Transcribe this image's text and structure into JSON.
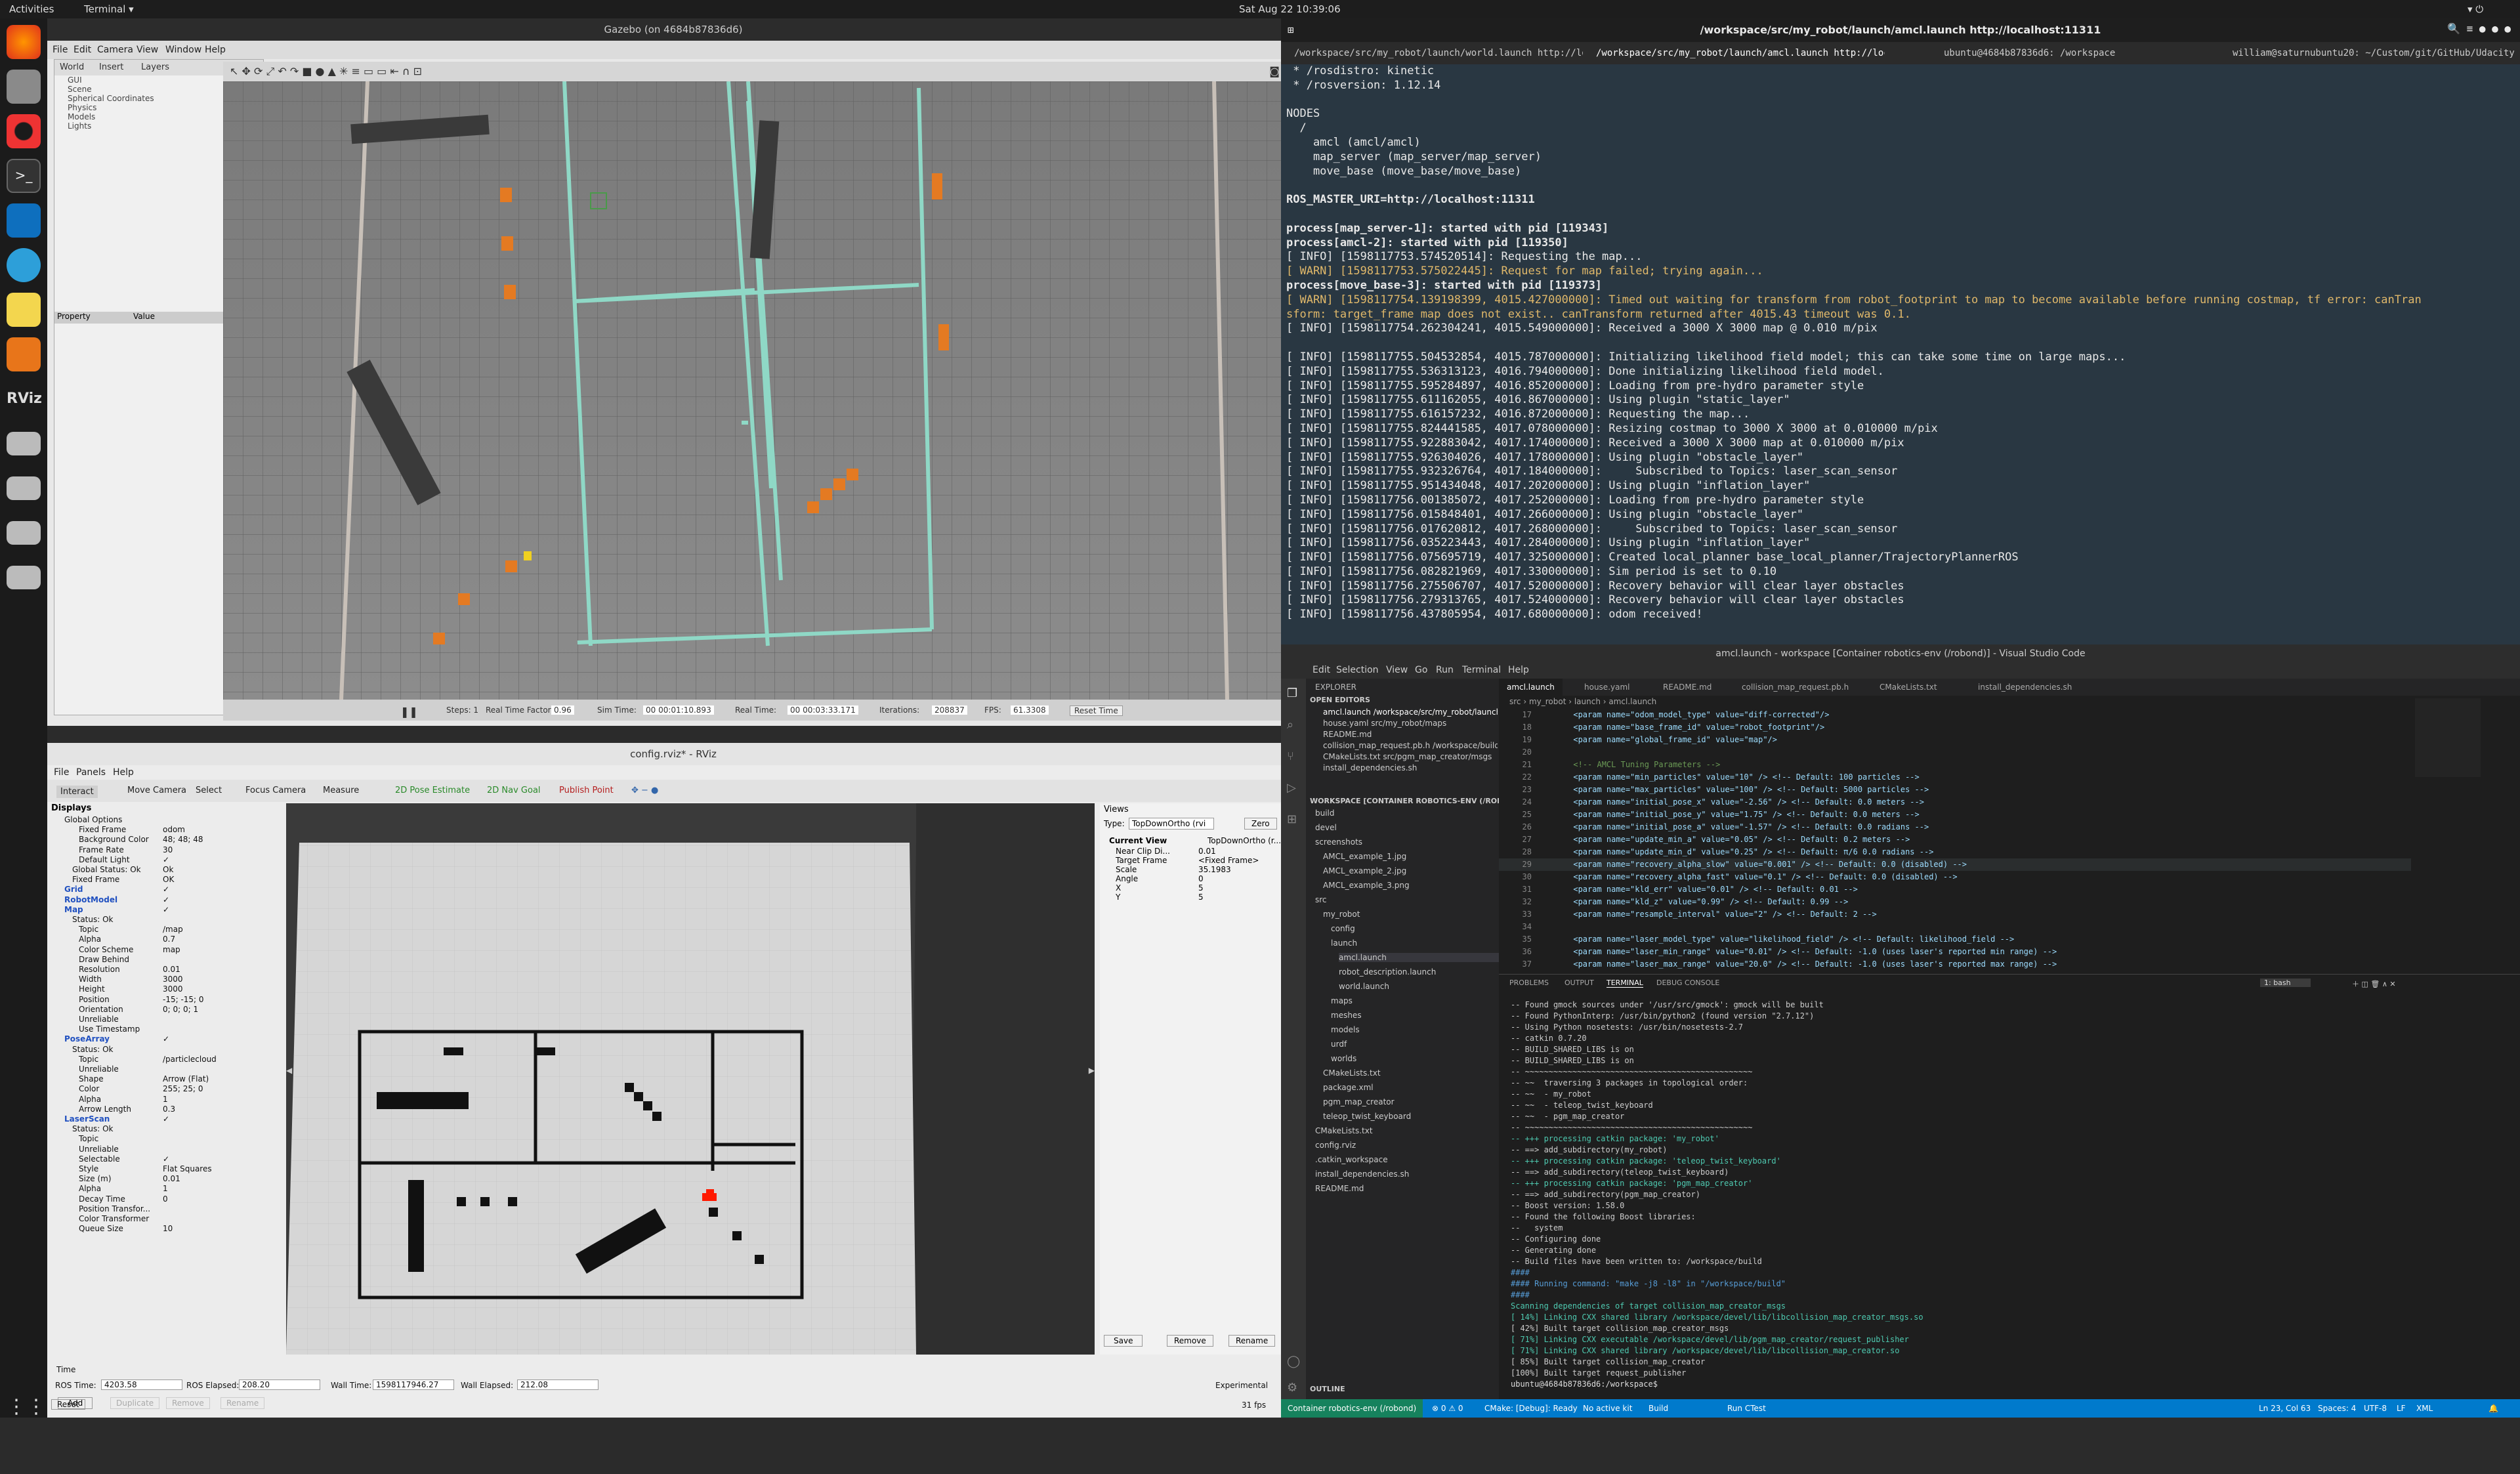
{
  "topbar": {
    "activities": "Activities",
    "app": "Terminal ▾",
    "clock": "Sat Aug 22  10:39:06"
  },
  "dock": {
    "items": [
      "firefox-icon",
      "files-icon",
      "rhythmbox-icon",
      "terminal-icon",
      "vscode-icon",
      "remmina-icon",
      "text-editor-icon",
      "layers-icon",
      "rviz-icon",
      "drive-icon",
      "drive-icon",
      "drive-icon",
      "drive-icon",
      "apps-grid-icon"
    ],
    "rviz_label": "RViz"
  },
  "gazebo": {
    "title": "Gazebo (on 4684b87836d6)",
    "menu": [
      "File",
      "Edit",
      "Camera",
      "View",
      "Window",
      "Help"
    ],
    "tabs": [
      "World",
      "Insert",
      "Layers"
    ],
    "tree": [
      "GUI",
      "Scene",
      "Spherical Coordinates",
      "Physics",
      "Models",
      "Lights"
    ],
    "prop_headers": [
      "Property",
      "Value"
    ],
    "bottom": {
      "steps": "Steps: 1",
      "rtf_label": "Real Time Factor:",
      "rtf": "0.96",
      "sim_label": "Sim Time:",
      "sim": "00 00:01:10.893",
      "real_label": "Real Time:",
      "real": "00 00:03:33.171",
      "iter_label": "Iterations:",
      "iter": "208837",
      "fps_label": "FPS:",
      "fps": "61.3308",
      "reset": "Reset Time"
    }
  },
  "rviz": {
    "title": "config.rviz* - RViz",
    "menu": [
      "File",
      "Panels",
      "Help"
    ],
    "tools": [
      "Interact",
      "Move Camera",
      "Select",
      "Focus Camera",
      "Measure",
      "2D Pose Estimate",
      "2D Nav Goal",
      "Publish Point"
    ],
    "displays_title": "Displays",
    "rows": [
      [
        "Global Options",
        ""
      ],
      [
        "Fixed Frame",
        "odom"
      ],
      [
        "Background Color",
        "48; 48; 48"
      ],
      [
        "Frame Rate",
        "30"
      ],
      [
        "Default Light",
        "✓"
      ],
      [
        "Global Status: Ok",
        "Ok"
      ],
      [
        "Fixed Frame",
        "OK"
      ],
      [
        "Grid",
        "✓"
      ],
      [
        "RobotModel",
        "✓"
      ],
      [
        "Map",
        "✓"
      ],
      [
        "Status: Ok",
        ""
      ],
      [
        "Topic",
        "/map"
      ],
      [
        "Alpha",
        "0.7"
      ],
      [
        "Color Scheme",
        "map"
      ],
      [
        "Draw Behind",
        ""
      ],
      [
        "Resolution",
        "0.01"
      ],
      [
        "Width",
        "3000"
      ],
      [
        "Height",
        "3000"
      ],
      [
        "Position",
        "-15; -15; 0"
      ],
      [
        "Orientation",
        "0; 0; 0; 1"
      ],
      [
        "Unreliable",
        ""
      ],
      [
        "Use Timestamp",
        ""
      ],
      [
        "PoseArray",
        "✓"
      ],
      [
        "Status: Ok",
        ""
      ],
      [
        "Topic",
        "/particlecloud"
      ],
      [
        "Unreliable",
        ""
      ],
      [
        "Shape",
        "Arrow (Flat)"
      ],
      [
        "Color",
        "255; 25; 0"
      ],
      [
        "Alpha",
        "1"
      ],
      [
        "Arrow Length",
        "0.3"
      ],
      [
        "LaserScan",
        "✓"
      ],
      [
        "Status: Ok",
        ""
      ],
      [
        "Topic",
        ""
      ],
      [
        "Unreliable",
        ""
      ],
      [
        "Selectable",
        "✓"
      ],
      [
        "Style",
        "Flat Squares"
      ],
      [
        "Size (m)",
        "0.01"
      ],
      [
        "Alpha",
        "1"
      ],
      [
        "Decay Time",
        "0"
      ],
      [
        "Position Transfor...",
        ""
      ],
      [
        "Color Transformer",
        ""
      ],
      [
        "Queue Size",
        "10"
      ]
    ],
    "disp_buttons": [
      "Add",
      "Duplicate",
      "Remove",
      "Rename"
    ],
    "views": {
      "title": "Views",
      "type_label": "Type:",
      "type": "TopDownOrtho (rvi",
      "zero": "Zero",
      "cv": "Current View",
      "cv_val": "TopDownOrtho (r...",
      "props": [
        [
          "Near Clip Di...",
          "0.01"
        ],
        [
          "Target Frame",
          "<Fixed Frame>"
        ],
        [
          "Scale",
          "35.1983"
        ],
        [
          "Angle",
          "0"
        ],
        [
          "X",
          "5"
        ],
        [
          "Y",
          "5"
        ]
      ],
      "buttons": [
        "Save",
        "Remove",
        "Rename"
      ]
    },
    "time": {
      "title": "Time",
      "ros_time_label": "ROS Time:",
      "ros_time": "4203.58",
      "ros_el_label": "ROS Elapsed:",
      "ros_el": "208.20",
      "wall_label": "Wall Time:",
      "wall": "1598117946.27",
      "wall_el_label": "Wall Elapsed:",
      "wall_el": "212.08",
      "experimental": "Experimental",
      "reset": "Reset",
      "fps": "31 fps"
    }
  },
  "terminal": {
    "title": "/workspace/src/my_robot/launch/amcl.launch http://localhost:11311",
    "tabs": [
      "/workspace/src/my_robot/launch/world.launch http://loc...",
      "/workspace/src/my_robot/launch/amcl.launch http://local...",
      "ubuntu@4684b87836d6: /workspace",
      "william@saturnubuntu20: ~/Custom/git/GitHub/Udacity-R..."
    ],
    "lines": [
      " * /rosdistro: kinetic",
      " * /rosversion: 1.12.14",
      "",
      "NODES",
      "  /",
      "    amcl (amcl/amcl)",
      "    map_server (map_server/map_server)",
      "    move_base (move_base/move_base)",
      "",
      "ROS_MASTER_URI=http://localhost:11311",
      "",
      "process[map_server-1]: started with pid [119343]",
      "process[amcl-2]: started with pid [119350]",
      "[ INFO] [1598117753.574520514]: Requesting the map...",
      "[ WARN] [1598117753.575022445]: Request for map failed; trying again...",
      "process[move_base-3]: started with pid [119373]",
      "[ WARN] [1598117754.139198399, 4015.427000000]: Timed out waiting for transform from robot_footprint to map to become available before running costmap, tf error: canTran",
      "sform: target_frame map does not exist.. canTransform returned after 4015.43 timeout was 0.1.",
      "[ INFO] [1598117754.262304241, 4015.549000000]: Received a 3000 X 3000 map @ 0.010 m/pix",
      "",
      "[ INFO] [1598117755.504532854, 4015.787000000]: Initializing likelihood field model; this can take some time on large maps...",
      "[ INFO] [1598117755.536313123, 4016.794000000]: Done initializing likelihood field model.",
      "[ INFO] [1598117755.595284897, 4016.852000000]: Loading from pre-hydro parameter style",
      "[ INFO] [1598117755.611162055, 4016.867000000]: Using plugin \"static_layer\"",
      "[ INFO] [1598117755.616157232, 4016.872000000]: Requesting the map...",
      "[ INFO] [1598117755.824441585, 4017.078000000]: Resizing costmap to 3000 X 3000 at 0.010000 m/pix",
      "[ INFO] [1598117755.922883042, 4017.174000000]: Received a 3000 X 3000 map at 0.010000 m/pix",
      "[ INFO] [1598117755.926304026, 4017.178000000]: Using plugin \"obstacle_layer\"",
      "[ INFO] [1598117755.932326764, 4017.184000000]:     Subscribed to Topics: laser_scan_sensor",
      "[ INFO] [1598117755.951434048, 4017.202000000]: Using plugin \"inflation_layer\"",
      "[ INFO] [1598117756.001385072, 4017.252000000]: Loading from pre-hydro parameter style",
      "[ INFO] [1598117756.015848401, 4017.266000000]: Using plugin \"obstacle_layer\"",
      "[ INFO] [1598117756.017620812, 4017.268000000]:     Subscribed to Topics: laser_scan_sensor",
      "[ INFO] [1598117756.035223443, 4017.284000000]: Using plugin \"inflation_layer\"",
      "[ INFO] [1598117756.075695719, 4017.325000000]: Created local_planner base_local_planner/TrajectoryPlannerROS",
      "[ INFO] [1598117756.082821969, 4017.330000000]: Sim period is set to 0.10",
      "[ INFO] [1598117756.275506707, 4017.520000000]: Recovery behavior will clear layer obstacles",
      "[ INFO] [1598117756.279313765, 4017.524000000]: Recovery behavior will clear layer obstacles",
      "[ INFO] [1598117756.437805954, 4017.680000000]: odom received!"
    ]
  },
  "vscode": {
    "title": "amcl.launch - workspace [Container robotics-env (/robond)] - Visual Studio Code",
    "menu": [
      "Edit",
      "Selection",
      "View",
      "Go",
      "Run",
      "Terminal",
      "Help"
    ],
    "explorer": "EXPLORER",
    "open_editors": "OPEN EDITORS",
    "open_files": [
      "amcl.launch  /workspace/src/my_robot/launch",
      "house.yaml  src/my_robot/maps",
      "README.md",
      "collision_map_request.pb.h  /workspace/build...",
      "CMakeLists.txt  src/pgm_map_creator/msgs",
      "install_dependencies.sh"
    ],
    "workspace": "WORKSPACE [CONTAINER ROBOTICS-ENV (/ROBOND)]",
    "tree": [
      "build",
      "devel",
      "screenshots",
      "AMCL_example_1.jpg",
      "AMCL_example_2.jpg",
      "AMCL_example_3.png",
      "src",
      "my_robot",
      "config",
      "launch",
      "amcl.launch",
      "robot_description.launch",
      "world.launch",
      "maps",
      "meshes",
      "models",
      "urdf",
      "worlds",
      "CMakeLists.txt",
      "package.xml",
      "pgm_map_creator",
      "teleop_twist_keyboard",
      "CMakeLists.txt",
      "config.rviz",
      ".catkin_workspace",
      "install_dependencies.sh",
      "README.md"
    ],
    "outline": "OUTLINE",
    "tabs": [
      "amcl.launch",
      "house.yaml",
      "README.md",
      "collision_map_request.pb.h",
      "CMakeLists.txt",
      "install_dependencies.sh"
    ],
    "breadcrumb": "src › my_robot › launch › amcl.launch",
    "code": [
      [
        "17",
        "      <param name=\"odom_model_type\" value=\"diff-corrected\"/>"
      ],
      [
        "18",
        "      <param name=\"base_frame_id\" value=\"robot_footprint\"/>"
      ],
      [
        "19",
        "      <param name=\"global_frame_id\" value=\"map\"/>"
      ],
      [
        "20",
        ""
      ],
      [
        "21",
        "      <!-- AMCL Tuning Parameters -->"
      ],
      [
        "22",
        "      <param name=\"min_particles\" value=\"10\" /> <!-- Default: 100 particles -->"
      ],
      [
        "23",
        "      <param name=\"max_particles\" value=\"100\" /> <!-- Default: 5000 particles -->"
      ],
      [
        "24",
        "      <param name=\"initial_pose_x\" value=\"-2.56\" /> <!-- Default: 0.0 meters -->"
      ],
      [
        "25",
        "      <param name=\"initial_pose_y\" value=\"1.75\" /> <!-- Default: 0.0 meters -->"
      ],
      [
        "26",
        "      <param name=\"initial_pose_a\" value=\"-1.57\" /> <!-- Default: 0.0 radians -->"
      ],
      [
        "27",
        "      <param name=\"update_min_a\" value=\"0.05\" /> <!-- Default: 0.2 meters -->"
      ],
      [
        "28",
        "      <param name=\"update_min_d\" value=\"0.25\" /> <!-- Default: π/6 0.0 radians -->"
      ],
      [
        "29",
        "      <param name=\"recovery_alpha_slow\" value=\"0.001\" /> <!-- Default: 0.0 (disabled) -->"
      ],
      [
        "30",
        "      <param name=\"recovery_alpha_fast\" value=\"0.1\" /> <!-- Default: 0.0 (disabled) -->"
      ],
      [
        "31",
        "      <param name=\"kld_err\" value=\"0.01\" /> <!-- Default: 0.01 -->"
      ],
      [
        "32",
        "      <param name=\"kld_z\" value=\"0.99\" /> <!-- Default: 0.99 -->"
      ],
      [
        "33",
        "      <param name=\"resample_interval\" value=\"2\" /> <!-- Default: 2 -->"
      ],
      [
        "34",
        ""
      ],
      [
        "35",
        "      <param name=\"laser_model_type\" value=\"likelihood_field\" /> <!-- Default: likelihood_field -->"
      ],
      [
        "36",
        "      <param name=\"laser_min_range\" value=\"0.01\" /> <!-- Default: -1.0 (uses laser's reported min range) -->"
      ],
      [
        "37",
        "      <param name=\"laser_max_range\" value=\"20.0\" /> <!-- Default: -1.0 (uses laser's reported max range) -->"
      ]
    ],
    "panel_tabs": [
      "PROBLEMS",
      "OUTPUT",
      "TERMINAL",
      "DEBUG CONSOLE"
    ],
    "panel_select": "1: bash",
    "panel_lines": [
      "-- Found gmock sources under '/usr/src/gmock': gmock will be built",
      "-- Found PythonInterp: /usr/bin/python2 (found version \"2.7.12\")",
      "-- Using Python nosetests: /usr/bin/nosetests-2.7",
      "-- catkin 0.7.20",
      "-- BUILD_SHARED_LIBS is on",
      "-- BUILD_SHARED_LIBS is on",
      "-- ~~~~~~~~~~~~~~~~~~~~~~~~~~~~~~~~~~~~~~~~~~~~~~~~",
      "-- ~~  traversing 3 packages in topological order:",
      "-- ~~  - my_robot",
      "-- ~~  - teleop_twist_keyboard",
      "-- ~~  - pgm_map_creator",
      "-- ~~~~~~~~~~~~~~~~~~~~~~~~~~~~~~~~~~~~~~~~~~~~~~~~",
      "-- +++ processing catkin package: 'my_robot'",
      "-- ==> add_subdirectory(my_robot)",
      "-- +++ processing catkin package: 'teleop_twist_keyboard'",
      "-- ==> add_subdirectory(teleop_twist_keyboard)",
      "-- +++ processing catkin package: 'pgm_map_creator'",
      "-- ==> add_subdirectory(pgm_map_creator)",
      "-- Boost version: 1.58.0",
      "-- Found the following Boost libraries:",
      "--   system",
      "-- Configuring done",
      "-- Generating done",
      "-- Build files have been written to: /workspace/build",
      "####",
      "#### Running command: \"make -j8 -l8\" in \"/workspace/build\"",
      "####",
      "Scanning dependencies of target collision_map_creator_msgs",
      "[ 14%] Linking CXX shared library /workspace/devel/lib/libcollision_map_creator_msgs.so",
      "[ 42%] Built target collision_map_creator_msgs",
      "[ 71%] Linking CXX executable /workspace/devel/lib/pgm_map_creator/request_publisher",
      "[ 71%] Linking CXX shared library /workspace/devel/lib/libcollision_map_creator.so",
      "[ 85%] Built target collision_map_creator",
      "[100%] Built target request_publisher",
      "ubuntu@4684b87836d6:/workspace$ "
    ],
    "status": {
      "remote": "Container robotics-env (/robond)",
      "problems": "⊗ 0  ⚠ 0",
      "cmake": "CMake: [Debug]: Ready",
      "kit": "No active kit",
      "build": "Build",
      "run": "Run CTest",
      "pos": "Ln 23, Col 63",
      "spaces": "Spaces: 4",
      "enc": "UTF-8",
      "eol": "LF",
      "lang": "XML"
    }
  },
  "colors": {
    "gazebo_bg": "#e8e8e8",
    "terminal_bg": "#293742",
    "vscode_bg": "#1e1e1e",
    "vscode_status": "#007acc",
    "map_wall": "#111111",
    "particle": "#ff1900"
  }
}
